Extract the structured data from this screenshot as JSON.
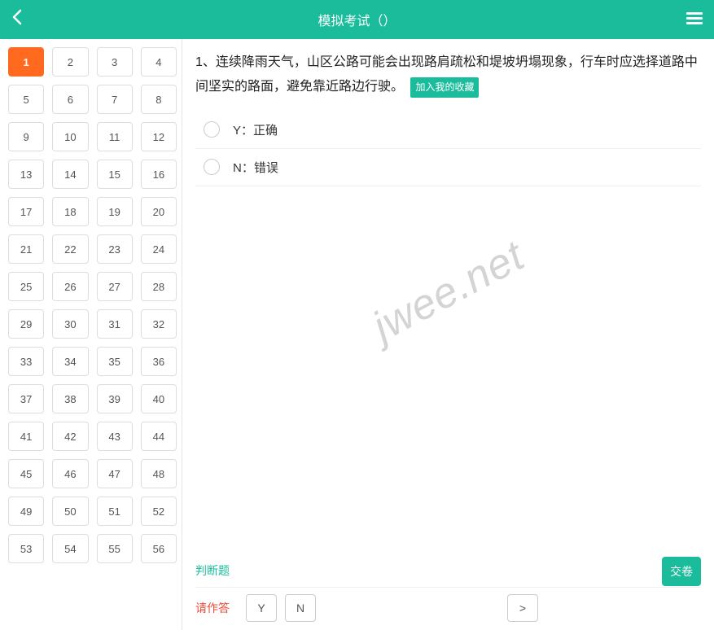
{
  "header": {
    "title": "模拟考试（）"
  },
  "sidebar": {
    "total": 56,
    "active": 1
  },
  "question": {
    "number": "1",
    "text": "连续降雨天气，山区公路可能会出现路肩疏松和堤坡坍塌现象，行车时应选择道路中间坚实的路面，避免靠近路边行驶。",
    "favorite_label": "加入我的收藏",
    "options": [
      {
        "key": "Y",
        "label": "Y：正确"
      },
      {
        "key": "N",
        "label": "N：错误"
      }
    ],
    "type_label": "判断题"
  },
  "footer": {
    "prompt": "请作答",
    "buttons": {
      "y": "Y",
      "n": "N",
      "next": ">"
    },
    "submit": "交卷"
  },
  "watermark": "jwee.net"
}
